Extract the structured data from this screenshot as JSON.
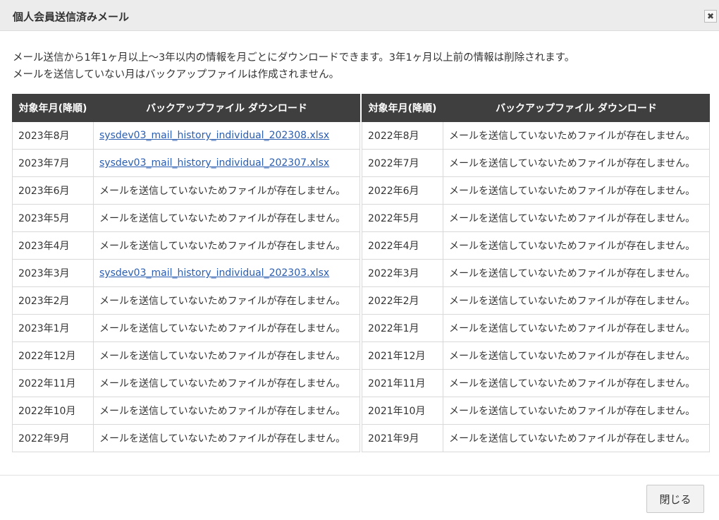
{
  "dialog": {
    "title": "個人会員送信済みメール",
    "close_icon_glyph": "✖",
    "intro_line1": "メール送信から1年1ヶ月以上～3年以内の情報を月ごとにダウンロードできます。3年1ヶ月以上前の情報は削除されます。",
    "intro_line2": "メールを送信していない月はバックアップファイルは作成されません。"
  },
  "table": {
    "headers": {
      "month": "対象年月(降順)",
      "file": "バックアップファイル ダウンロード"
    },
    "left_rows": [
      {
        "month": "2023年8月",
        "file": "sysdev03_mail_history_individual_202308.xlsx",
        "is_link": true
      },
      {
        "month": "2023年7月",
        "file": "sysdev03_mail_history_individual_202307.xlsx",
        "is_link": true
      },
      {
        "month": "2023年6月",
        "file": "メールを送信していないためファイルが存在しません。",
        "is_link": false
      },
      {
        "month": "2023年5月",
        "file": "メールを送信していないためファイルが存在しません。",
        "is_link": false
      },
      {
        "month": "2023年4月",
        "file": "メールを送信していないためファイルが存在しません。",
        "is_link": false
      },
      {
        "month": "2023年3月",
        "file": "sysdev03_mail_history_individual_202303.xlsx",
        "is_link": true
      },
      {
        "month": "2023年2月",
        "file": "メールを送信していないためファイルが存在しません。",
        "is_link": false
      },
      {
        "month": "2023年1月",
        "file": "メールを送信していないためファイルが存在しません。",
        "is_link": false
      },
      {
        "month": "2022年12月",
        "file": "メールを送信していないためファイルが存在しません。",
        "is_link": false
      },
      {
        "month": "2022年11月",
        "file": "メールを送信していないためファイルが存在しません。",
        "is_link": false
      },
      {
        "month": "2022年10月",
        "file": "メールを送信していないためファイルが存在しません。",
        "is_link": false
      },
      {
        "month": "2022年9月",
        "file": "メールを送信していないためファイルが存在しません。",
        "is_link": false
      }
    ],
    "right_rows": [
      {
        "month": "2022年8月",
        "file": "メールを送信していないためファイルが存在しません。",
        "is_link": false
      },
      {
        "month": "2022年7月",
        "file": "メールを送信していないためファイルが存在しません。",
        "is_link": false
      },
      {
        "month": "2022年6月",
        "file": "メールを送信していないためファイルが存在しません。",
        "is_link": false
      },
      {
        "month": "2022年5月",
        "file": "メールを送信していないためファイルが存在しません。",
        "is_link": false
      },
      {
        "month": "2022年4月",
        "file": "メールを送信していないためファイルが存在しません。",
        "is_link": false
      },
      {
        "month": "2022年3月",
        "file": "メールを送信していないためファイルが存在しません。",
        "is_link": false
      },
      {
        "month": "2022年2月",
        "file": "メールを送信していないためファイルが存在しません。",
        "is_link": false
      },
      {
        "month": "2022年1月",
        "file": "メールを送信していないためファイルが存在しません。",
        "is_link": false
      },
      {
        "month": "2021年12月",
        "file": "メールを送信していないためファイルが存在しません。",
        "is_link": false
      },
      {
        "month": "2021年11月",
        "file": "メールを送信していないためファイルが存在しません。",
        "is_link": false
      },
      {
        "month": "2021年10月",
        "file": "メールを送信していないためファイルが存在しません。",
        "is_link": false
      },
      {
        "month": "2021年9月",
        "file": "メールを送信していないためファイルが存在しません。",
        "is_link": false
      }
    ]
  },
  "footer": {
    "close_label": "閉じる"
  }
}
